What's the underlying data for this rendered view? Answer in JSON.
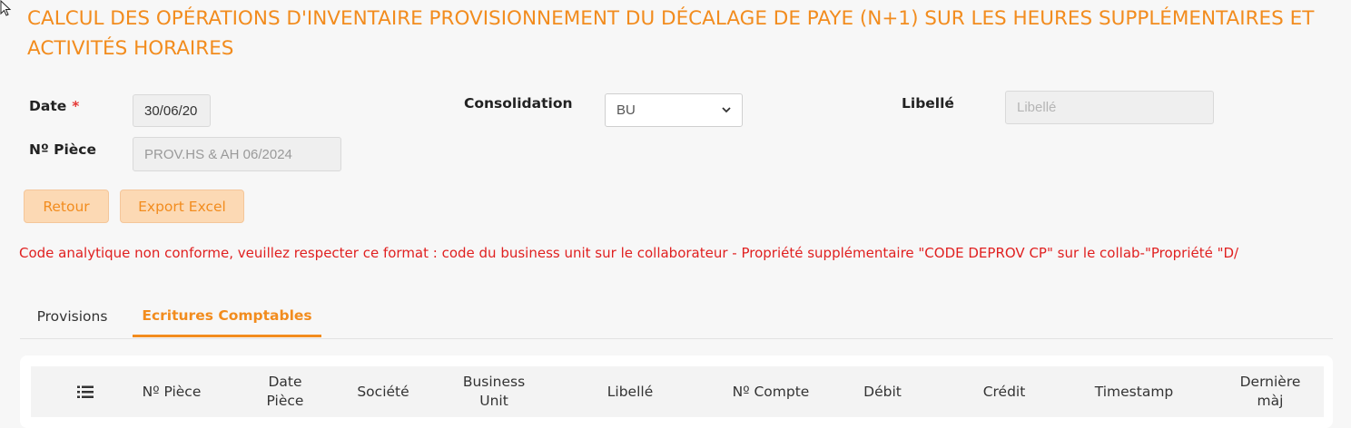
{
  "header": {
    "title": "CALCUL DES OPÉRATIONS D'INVENTAIRE PROVISIONNEMENT DU DÉCALAGE DE PAYE (N+1) SUR LES HEURES SUPPLÉMENTAIRES ET ACTIVITÉS HORAIRES"
  },
  "form": {
    "date_label": "Date",
    "required_marker": "*",
    "date_value": "30/06/20",
    "piece_label": "Nº Pièce",
    "piece_placeholder": "PROV.HS & AH 06/2024",
    "consolidation_label": "Consolidation",
    "consolidation_selected": "BU",
    "libelle_label": "Libellé",
    "libelle_placeholder": "Libellé"
  },
  "actions": {
    "back_label": "Retour",
    "export_label": "Export Excel"
  },
  "error": {
    "message": "Code analytique non conforme, veuillez respecter ce format : code du business unit sur le collaborateur - Propriété supplémentaire \"CODE DEPROV CP\" sur le collab-\"Propriété \"D/"
  },
  "tabs": [
    {
      "label": "Provisions",
      "active": false
    },
    {
      "label": "Ecritures Comptables",
      "active": true
    }
  ],
  "table": {
    "columns": [
      {
        "icon": "list-icon"
      },
      {
        "label": "Nº Pièce"
      },
      {
        "label": "Date Pièce"
      },
      {
        "label": "Société"
      },
      {
        "label": "Business Unit"
      },
      {
        "label": "Libellé"
      },
      {
        "label": "Nº Compte"
      },
      {
        "label": "Débit"
      },
      {
        "label": "Crédit"
      },
      {
        "label": "Timestamp"
      },
      {
        "label": "Dernière màj"
      }
    ]
  },
  "colors": {
    "accent": "#f28c1e",
    "button_bg": "#fcd9b4",
    "error": "#e02020",
    "background": "#f7f7f7"
  }
}
